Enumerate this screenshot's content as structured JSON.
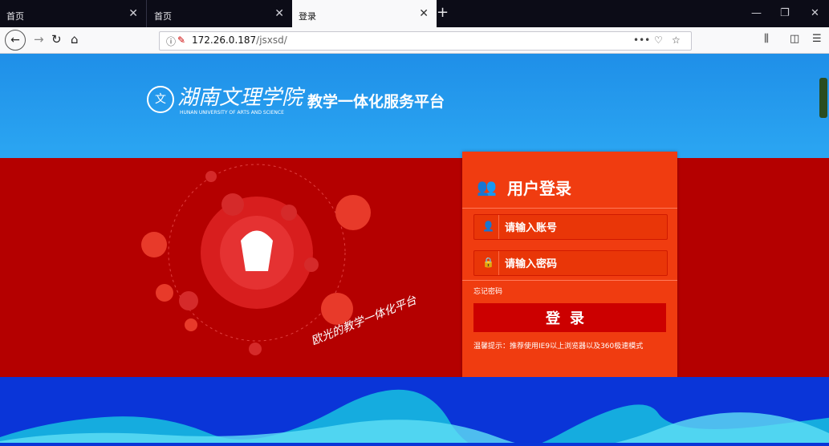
{
  "browser": {
    "tabs": [
      {
        "label": "首页"
      },
      {
        "label": "首页"
      },
      {
        "label": "登录"
      }
    ],
    "url_host": "172.26.0.187",
    "url_path": "/jsxsd/"
  },
  "header": {
    "school_name_cn": "湖南文理学院",
    "school_name_en": "HUNAN UNIVERSITY OF ARTS AND SCIENCE",
    "platform_name": "教学一体化服务平台"
  },
  "illustration": {
    "slogan": "欧光的教学一体化平台"
  },
  "login": {
    "title": "用户登录",
    "username_placeholder": "请输入账号",
    "password_placeholder": "请输入密码",
    "forgot_label": "忘记密码",
    "submit_label": "登录",
    "tip": "温馨提示：推荐使用IE9以上浏览器以及360极速模式"
  },
  "colors": {
    "brand_blue": "#2aa3f0",
    "band_red": "#b40000",
    "panel_orange": "#f03c10",
    "footer_blue": "#0a35d8"
  }
}
